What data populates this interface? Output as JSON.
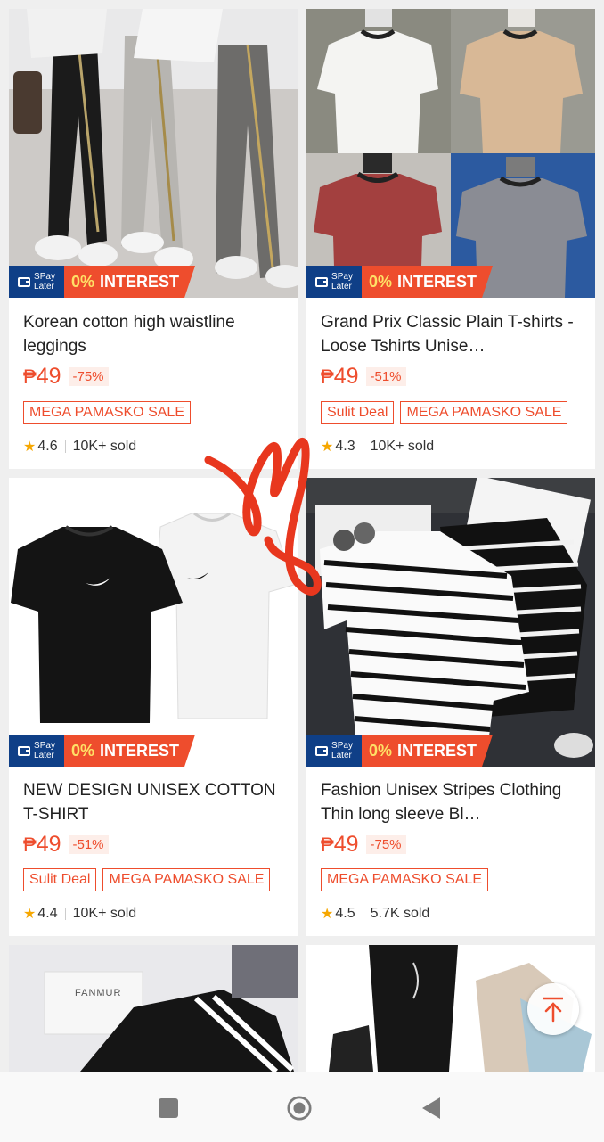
{
  "products": [
    {
      "title": "Korean cotton high waistline leggings",
      "price_symbol": "₱",
      "price": "49",
      "discount": "-75%",
      "tags": [
        "MEGA PAMASKO SALE"
      ],
      "rating": "4.6",
      "sold": "10K+ sold",
      "spay": [
        "SPay",
        "Later"
      ],
      "interest_pct": "0%",
      "interest_word": "INTEREST"
    },
    {
      "title": "Grand Prix Classic Plain T-shirts -Loose Tshirts Unise…",
      "price_symbol": "₱",
      "price": "49",
      "discount": "-51%",
      "tags": [
        "Sulit Deal",
        "MEGA PAMASKO SALE"
      ],
      "rating": "4.3",
      "sold": "10K+ sold",
      "spay": [
        "SPay",
        "Later"
      ],
      "interest_pct": "0%",
      "interest_word": "INTEREST"
    },
    {
      "title": "NEW DESIGN UNISEX COTTON T-SHIRT",
      "price_symbol": "₱",
      "price": "49",
      "discount": "-51%",
      "tags": [
        "Sulit Deal",
        "MEGA PAMASKO SALE"
      ],
      "rating": "4.4",
      "sold": "10K+ sold",
      "spay": [
        "SPay",
        "Later"
      ],
      "interest_pct": "0%",
      "interest_word": "INTEREST"
    },
    {
      "title": "Fashion Unisex Stripes Clothing Thin long sleeve Bl…",
      "price_symbol": "₱",
      "price": "49",
      "discount": "-75%",
      "tags": [
        "MEGA PAMASKO SALE"
      ],
      "rating": "4.5",
      "sold": "5.7K sold",
      "spay": [
        "SPay",
        "Later"
      ],
      "interest_pct": "0%",
      "interest_word": "INTEREST"
    }
  ],
  "partial_card_text": "FANMUR",
  "colors": {
    "accent": "#ee4d2d",
    "spay_blue": "#0f3f87",
    "star": "#f6a700",
    "scrawl": "#e8371e"
  },
  "icons": {
    "star": "star-icon",
    "back_to_top": "arrow-up-icon",
    "nav": [
      "square-icon",
      "circle-icon",
      "triangle-back-icon"
    ]
  }
}
